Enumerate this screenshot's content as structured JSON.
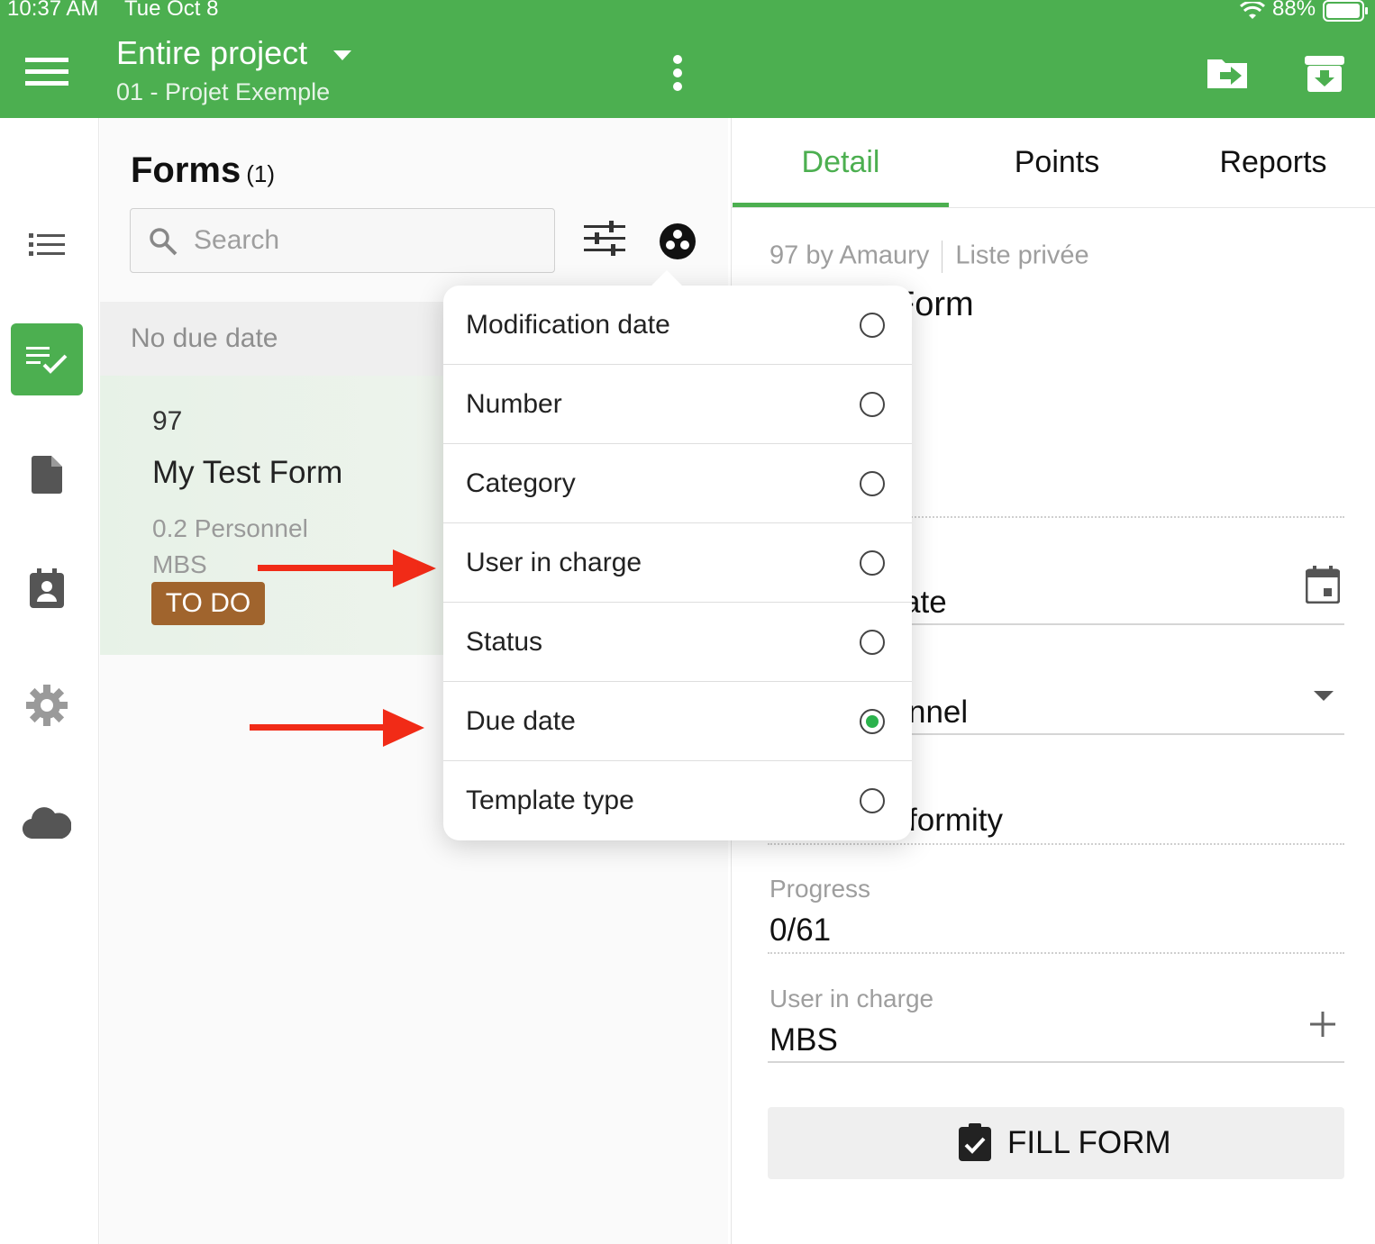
{
  "status_bar": {
    "time": "10:37 AM",
    "date": "Tue Oct 8",
    "battery": "88%"
  },
  "header": {
    "title": "Entire project",
    "subtitle": "01 - Projet Exemple"
  },
  "sidebar": {
    "items": [
      {
        "icon": "list-icon",
        "active": false
      },
      {
        "icon": "checklist-icon",
        "active": true
      },
      {
        "icon": "document-icon",
        "active": false
      },
      {
        "icon": "contact-icon",
        "active": false
      },
      {
        "icon": "gear-icon",
        "active": false
      },
      {
        "icon": "cloud-icon",
        "active": false
      }
    ]
  },
  "forms": {
    "title": "Forms",
    "count": "(1)",
    "search_placeholder": "Search",
    "group_label": "No due date",
    "card": {
      "number": "97",
      "title": "My Test Form",
      "category": "0.2 Personnel",
      "user": "MBS",
      "status": "TO DO"
    }
  },
  "sort_menu": {
    "options": [
      {
        "label": "Modification date",
        "selected": false
      },
      {
        "label": "Number",
        "selected": false
      },
      {
        "label": "Category",
        "selected": false
      },
      {
        "label": "User in charge",
        "selected": false
      },
      {
        "label": "Status",
        "selected": false
      },
      {
        "label": "Due date",
        "selected": true
      },
      {
        "label": "Template type",
        "selected": false
      }
    ]
  },
  "detail": {
    "tabs": [
      "Detail",
      "Points",
      "Reports"
    ],
    "active_tab": "Detail",
    "meta_left": "97 by Amaury",
    "meta_right": "Liste privée",
    "title_partial": "Form",
    "due_date_partial": "ate",
    "category_partial": "nnel",
    "conformity_partial": "formity",
    "progress_label": "Progress",
    "progress_value": "0/61",
    "user_label": "User in charge",
    "user_value": "MBS",
    "fill_button": "FILL FORM"
  },
  "colors": {
    "brand_green": "#4caf50",
    "badge_brown": "#a0642d",
    "arrow_red": "#f12b17",
    "radio_green": "#2bb24c"
  }
}
